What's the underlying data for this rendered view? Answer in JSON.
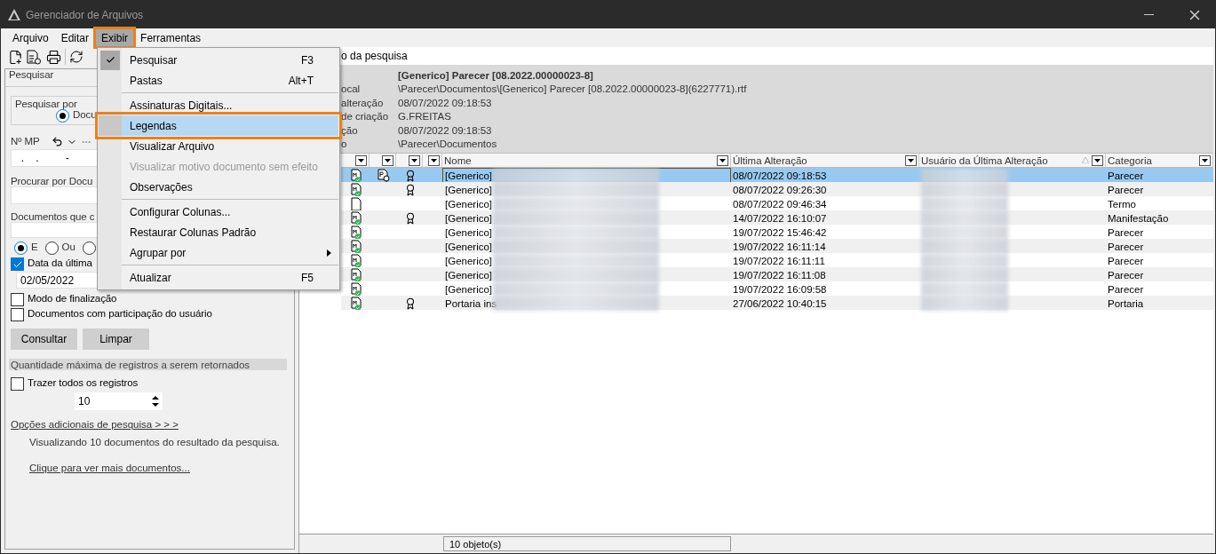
{
  "window": {
    "title": "Gerenciador de Arquivos"
  },
  "menu_bar": [
    {
      "label": "Arquivo",
      "open": false
    },
    {
      "label": "Editar",
      "open": false
    },
    {
      "label": "Exibir",
      "open": true
    },
    {
      "label": "Ferramentas",
      "open": false
    }
  ],
  "open_menu": {
    "items": [
      {
        "kind": "item",
        "label": "Pesquisar",
        "shortcut": "F3",
        "checked": true,
        "selected": false,
        "disabled": false
      },
      {
        "kind": "item",
        "label": "Pastas",
        "shortcut": "Alt+T",
        "checked": false,
        "selected": false,
        "disabled": false
      },
      {
        "kind": "separator"
      },
      {
        "kind": "item",
        "label": "Assinaturas Digitais...",
        "checked": false,
        "selected": false,
        "disabled": false
      },
      {
        "kind": "item",
        "label": "Legendas",
        "checked": false,
        "selected": true,
        "disabled": false
      },
      {
        "kind": "item",
        "label": "Visualizar Arquivo",
        "checked": false,
        "selected": false,
        "disabled": false
      },
      {
        "kind": "item",
        "label": "Visualizar motivo documento sem efeito",
        "checked": false,
        "selected": false,
        "disabled": true
      },
      {
        "kind": "item",
        "label": "Observações",
        "checked": false,
        "selected": false,
        "disabled": false
      },
      {
        "kind": "separator"
      },
      {
        "kind": "item",
        "label": "Configurar Colunas...",
        "checked": false,
        "selected": false,
        "disabled": false
      },
      {
        "kind": "item",
        "label": "Restaurar Colunas Padrão",
        "checked": false,
        "selected": false,
        "disabled": false
      },
      {
        "kind": "submenu",
        "label": "Agrupar por",
        "checked": false,
        "selected": false,
        "disabled": false
      },
      {
        "kind": "separator"
      },
      {
        "kind": "item",
        "label": "Atualizar",
        "shortcut": "F5",
        "checked": false,
        "selected": false,
        "disabled": false
      }
    ]
  },
  "search_panel": {
    "title": "Pesquisar",
    "search_by": {
      "label": "Pesquisar por",
      "options": [
        {
          "label": "Docu",
          "selected": true
        }
      ]
    },
    "mp": {
      "label": "Nº MP",
      "value": "  .    .         -"
    },
    "doc_search": {
      "label": "Procurar por Docu"
    },
    "docs_containing": {
      "label": "Documentos que c"
    },
    "logic_options": [
      {
        "label": "E",
        "selected": true
      },
      {
        "label": "Ou",
        "selected": false
      },
      {
        "selected": false
      }
    ],
    "date_filter": {
      "label": "Data da última",
      "checked": true,
      "value": "02/05/2022"
    },
    "checkboxes": [
      {
        "label": "Modo de finalização",
        "checked": false
      },
      {
        "label": "Documentos com participação do usuário",
        "checked": false
      }
    ],
    "buttons": [
      "Consultar",
      "Limpar"
    ],
    "limit": {
      "heading": "Quantidade máxima de registros a serem retornados",
      "all": {
        "label": "Trazer todos os registros",
        "checked": false
      },
      "value": "10"
    },
    "more_options_link": "Opções adicionais de pesquisa > > >",
    "info": "Visualizando 10 documentos do resultado da pesquisa.",
    "more_docs_link": "Clique para ver mais documentos..."
  },
  "search_field": {
    "value": "o da pesquisa"
  },
  "details": {
    "title": "[Generico] Parecer [08.2022.00000023-8]",
    "rows": [
      {
        "label": "ocal",
        "value": "\\Parecer\\Documentos\\[Generico] Parecer [08.2022.00000023-8](6227771).rtf"
      },
      {
        "label": "alteração",
        "value": "08/07/2022 09:18:53"
      },
      {
        "label": "de criação",
        "value": "G.FREITAS"
      },
      {
        "label": "ção",
        "value": "08/07/2022 09:18:53"
      },
      {
        "label": "o",
        "value": "\\Parecer\\Documentos"
      }
    ]
  },
  "table": {
    "columns": [
      {
        "kind": "blank"
      },
      {
        "kind": "filter"
      },
      {
        "kind": "filter"
      },
      {
        "kind": "filter"
      },
      {
        "kind": "filter"
      },
      {
        "kind": "named",
        "label": "Nome",
        "sorted": false
      },
      {
        "kind": "named",
        "label": "Última Alteração",
        "sorted": false
      },
      {
        "kind": "named",
        "label": "Usuário da Última Alteração",
        "sorted": true
      },
      {
        "kind": "named",
        "label": "Categoria",
        "sorted": false
      }
    ],
    "rows": [
      {
        "selected": true,
        "signed": true,
        "attachment": true,
        "seal": true,
        "name": "[Generico]",
        "modified": "08/07/2022 09:18:53",
        "category": "Parecer"
      },
      {
        "selected": false,
        "signed": true,
        "attachment": false,
        "seal": true,
        "name": "[Generico]",
        "modified": "08/07/2022 09:26:30",
        "category": "Parecer"
      },
      {
        "selected": false,
        "signed": false,
        "attachment": false,
        "seal": false,
        "name": "[Generico]",
        "modified": "08/07/2022 09:46:34",
        "category": "Termo"
      },
      {
        "selected": false,
        "signed": true,
        "attachment": false,
        "seal": true,
        "name": "[Generico]",
        "modified": "14/07/2022 16:10:07",
        "category": "Manifestação"
      },
      {
        "selected": false,
        "signed": true,
        "attachment": false,
        "seal": false,
        "name": "[Generico]",
        "modified": "19/07/2022 15:46:42",
        "category": "Parecer"
      },
      {
        "selected": false,
        "signed": true,
        "attachment": false,
        "seal": false,
        "name": "[Generico]",
        "modified": "19/07/2022 16:11:14",
        "category": "Parecer"
      },
      {
        "selected": false,
        "signed": true,
        "attachment": false,
        "seal": false,
        "name": "[Generico]",
        "modified": "19/07/2022 16:11:11",
        "category": "Parecer"
      },
      {
        "selected": false,
        "signed": true,
        "attachment": false,
        "seal": false,
        "name": "[Generico]",
        "modified": "19/07/2022 16:11:08",
        "category": "Parecer"
      },
      {
        "selected": false,
        "signed": true,
        "attachment": false,
        "seal": false,
        "name": "[Generico]",
        "modified": "19/07/2022 16:09:58",
        "category": "Parecer"
      },
      {
        "selected": false,
        "signed": true,
        "attachment": false,
        "seal": true,
        "name": "Portaria ins",
        "modified": "27/06/2022 10:40:15",
        "category": "Portaria"
      }
    ]
  },
  "status_bar": {
    "count": "10 objeto(s)"
  }
}
